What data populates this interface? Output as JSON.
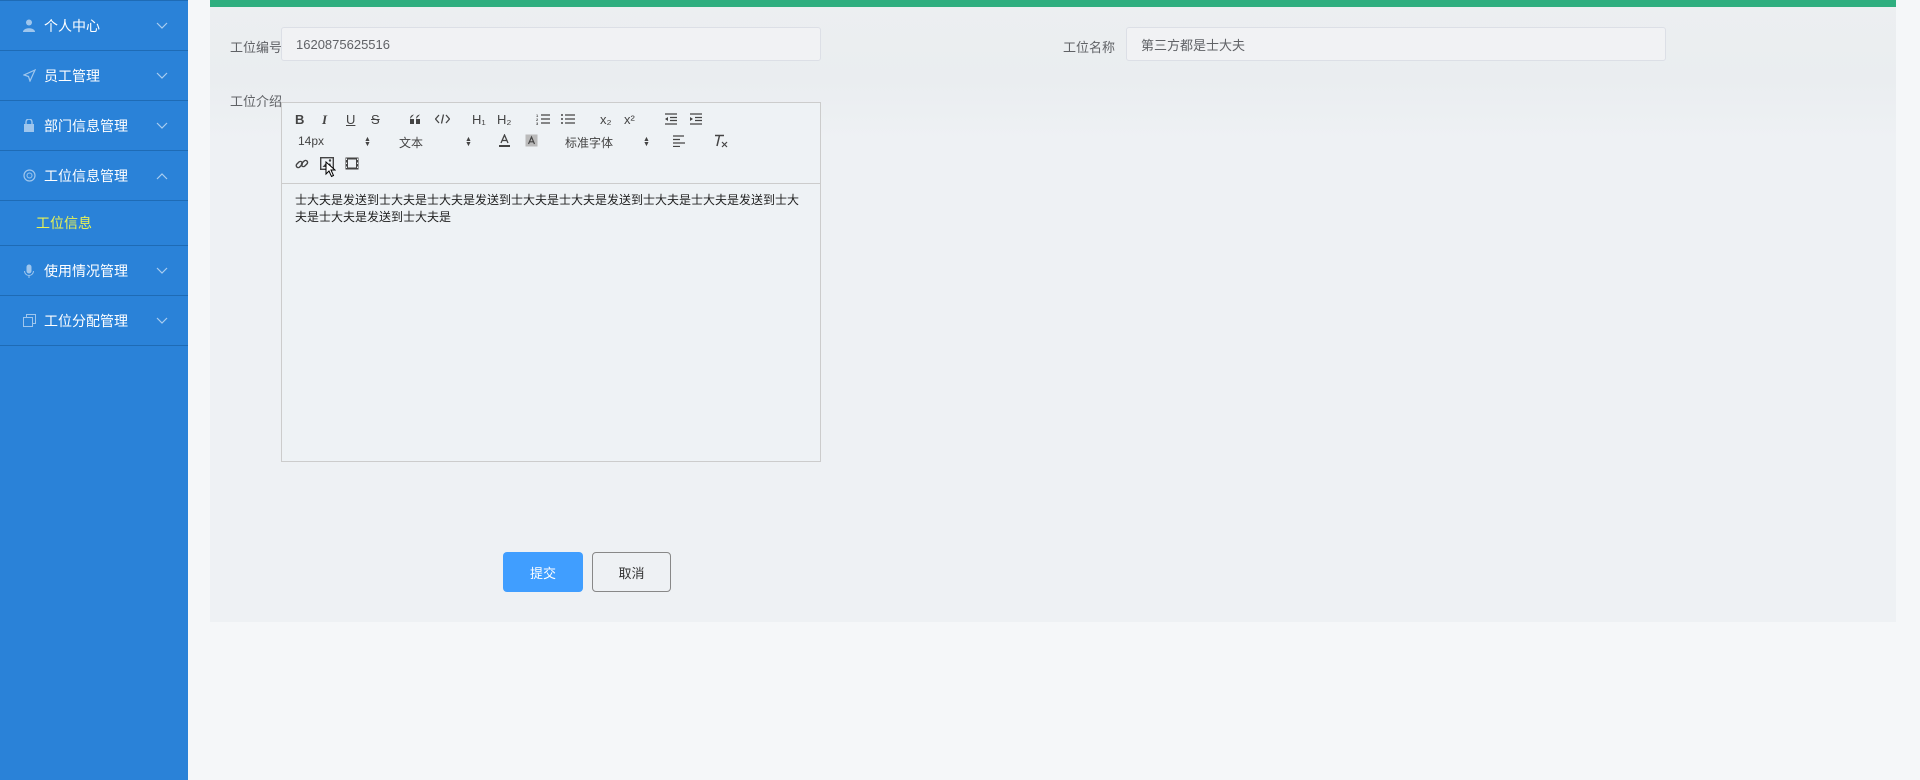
{
  "sidebar": {
    "items": [
      {
        "label": "个人中心",
        "icon": "user-icon"
      },
      {
        "label": "员工管理",
        "icon": "send-icon"
      },
      {
        "label": "部门信息管理",
        "icon": "lock-icon"
      },
      {
        "label": "工位信息管理",
        "icon": "circle-icon",
        "expanded": true
      },
      {
        "label": "使用情况管理",
        "icon": "microphone-icon"
      },
      {
        "label": "工位分配管理",
        "icon": "copy-icon"
      }
    ],
    "submenu": {
      "label": "工位信息"
    }
  },
  "form": {
    "id_label": "工位编号",
    "id_value": "1620875625516",
    "name_label": "工位名称",
    "name_value": "第三方都是士大夫",
    "intro_label": "工位介绍",
    "intro_content": "士大夫是发送到士大夫是士大夫是发送到士大夫是士大夫是发送到士大夫是士大夫是发送到士大夫是士大夫是发送到士大夫是",
    "submit_label": "提交",
    "cancel_label": "取消"
  },
  "editor": {
    "font_size": "14px",
    "header_select": "文本",
    "font_family": "标准字体",
    "toolbar": {
      "bold": "B",
      "italic": "I",
      "underline": "U",
      "strike": "S",
      "h1": "H₁",
      "h2": "H₂",
      "sub": "x₂",
      "sup": "x²"
    }
  },
  "colors": {
    "sidebar_bg": "#2a82d8",
    "active_submenu": "#e8f255",
    "top_bar": "#2fae7f",
    "primary_button": "#409eff"
  }
}
